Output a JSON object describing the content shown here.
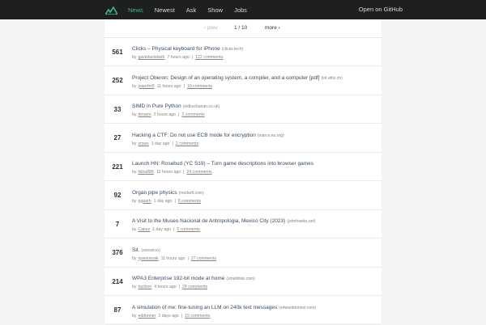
{
  "nav": {
    "items": [
      "News",
      "Newest",
      "Ask",
      "Show",
      "Jobs"
    ],
    "active_index": 0,
    "github": "Open on GitHub"
  },
  "pager": {
    "prev": "‹ prev",
    "page": "1 / 10",
    "more": "more ›"
  },
  "colors": {
    "accent": "#3fb984",
    "topbar": "#1d1f21",
    "score": "#1f2d3d"
  },
  "items": [
    {
      "score": "561",
      "title": "Clicks – Physical keyboard for iPhone",
      "domain": "(clicks.tech)",
      "by": "by",
      "user": "gavinlackdash",
      "time": "7 hours ago",
      "comments": "122 comments"
    },
    {
      "score": "252",
      "title": "Project Oberon: Design of an operating system, a compiler, and a computer [pdf]",
      "domain": "(inf.ethz.ch)",
      "by": "by",
      "user": "joaorfm5",
      "time": "11 hours ago",
      "comments": "10 comments"
    },
    {
      "score": "33",
      "title": "SIMD in Pure Python",
      "domain": "(eidbuchanan.co.uk)",
      "by": "by",
      "user": "dmarto",
      "time": "2 hours ago",
      "comments": "2 comments"
    },
    {
      "score": "27",
      "title": "Hacking a CTF: Do not use ECB mode for encryption",
      "domain": "(marco.eu.org)",
      "by": "by",
      "user": "zrsws",
      "time": "1 day ago",
      "comments": "2 comments"
    },
    {
      "score": "221",
      "title": "Launch HN: Rosebud (YC S19) – Turn game descriptions into browser games",
      "domain": "",
      "by": "by",
      "user": "lisha888",
      "time": "12 hours ago",
      "comments": "24 comments"
    },
    {
      "score": "92",
      "title": "Organ pipe physics",
      "domain": "(modartt.com)",
      "by": "by",
      "user": "pgaarh",
      "time": "1 day ago",
      "comments": "8 comments"
    },
    {
      "score": "7",
      "title": "A Visit to the Museo Nacional de Antropologia, Mexico City (2023)",
      "domain": "(johnhawks.net)",
      "by": "by",
      "user": "Cakez",
      "time": "1 day ago",
      "comments": "0 comments"
    },
    {
      "score": "376",
      "title": "Sit.",
      "domain": "(sonset.io)",
      "by": "by",
      "user": "rpastuszak",
      "time": "11 hours ago",
      "comments": "27 comments"
    },
    {
      "score": "214",
      "title": "WPA3 Enterprise 192-bit mode at home",
      "domain": "(smallstep.com)",
      "by": "by",
      "user": "tachion",
      "time": "4 hours ago",
      "comments": "28 comments"
    },
    {
      "score": "87",
      "title": "A simulation of me: fine-tuning an LLM on 240k text messages",
      "domain": "(edwarddonner.com)",
      "by": "by",
      "user": "eddonner",
      "time": "2 days ago",
      "comments": "15 comments"
    }
  ]
}
